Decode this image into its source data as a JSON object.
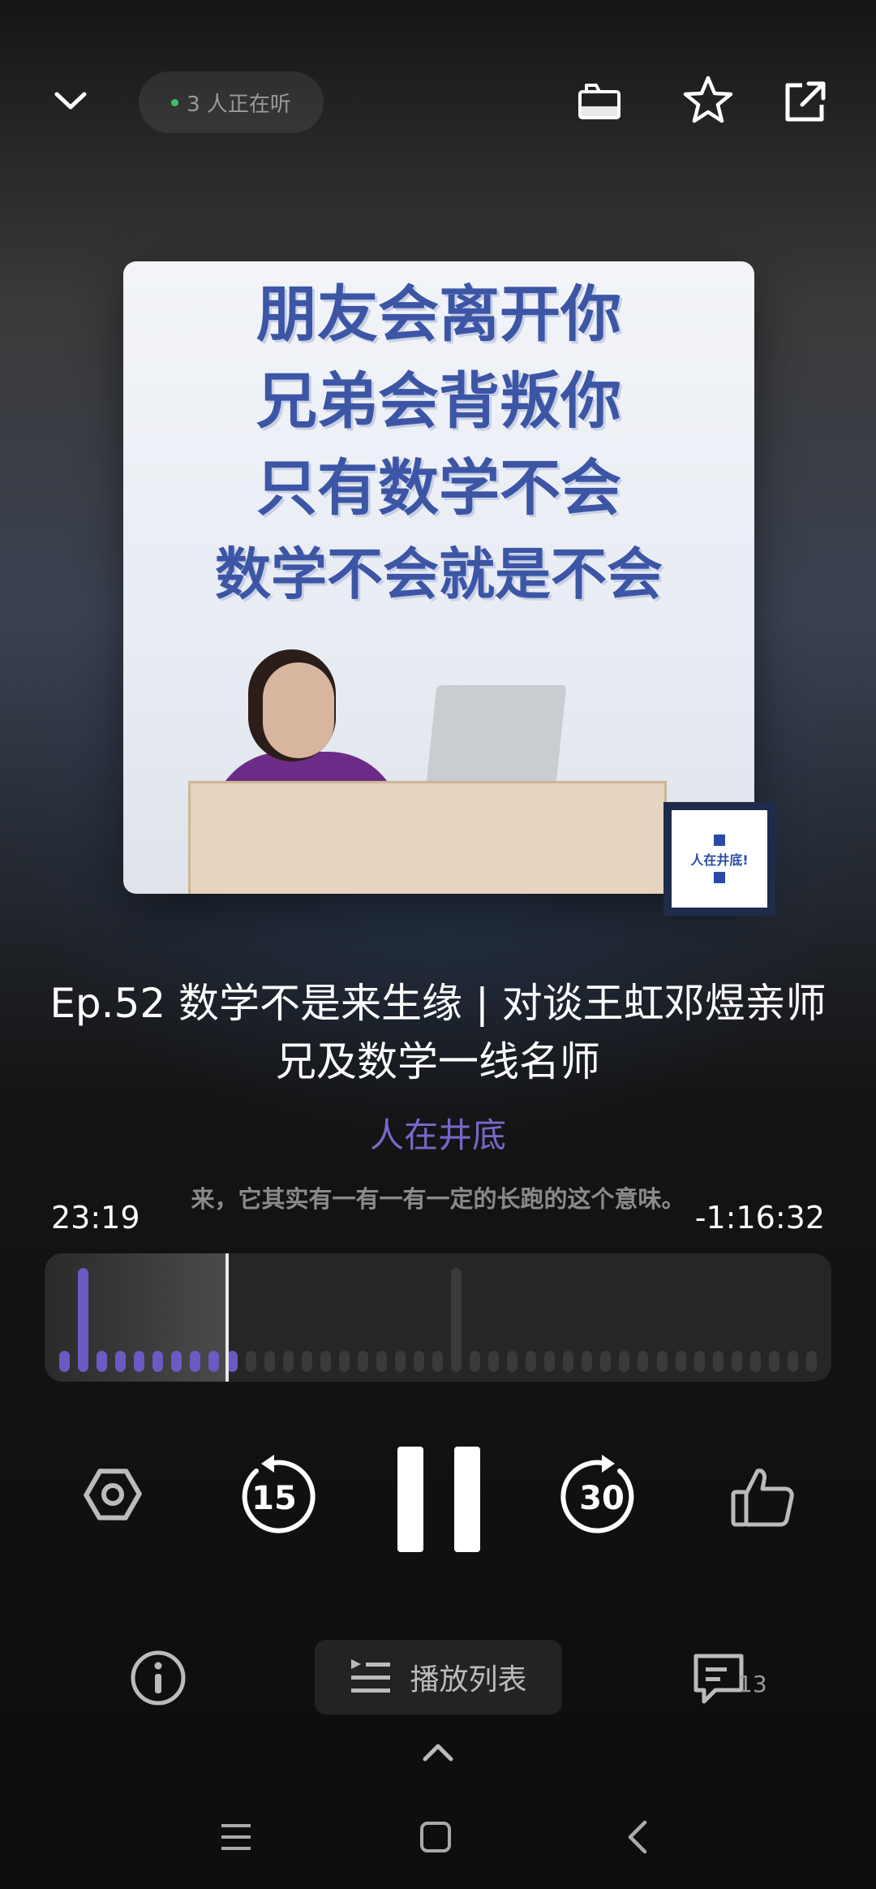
{
  "header": {
    "listeners_text": "3 人正在听",
    "colors": {
      "live_dot": "#3fbf6a"
    }
  },
  "cover": {
    "lines": [
      "朋友会离开你",
      "兄弟会背叛你",
      "只有数学不会",
      "数学不会就是不会"
    ],
    "badge_text": "人在井底!"
  },
  "episode": {
    "title": "Ep.52 数学不是来生缘 | 对谈王虹邓煜亲师兄及数学一线名师",
    "podcast": "人在井底"
  },
  "player": {
    "elapsed": "23:19",
    "remaining": "-1:16:32",
    "lyric": "来，它其实有一有一有一定的长跑的这个意味。",
    "progress_fraction": 0.23,
    "skip_back": "15",
    "skip_forward": "30",
    "colors": {
      "accent": "#6a5bc4"
    }
  },
  "bottom": {
    "playlist_label": "播放列表",
    "comment_count": "13"
  }
}
